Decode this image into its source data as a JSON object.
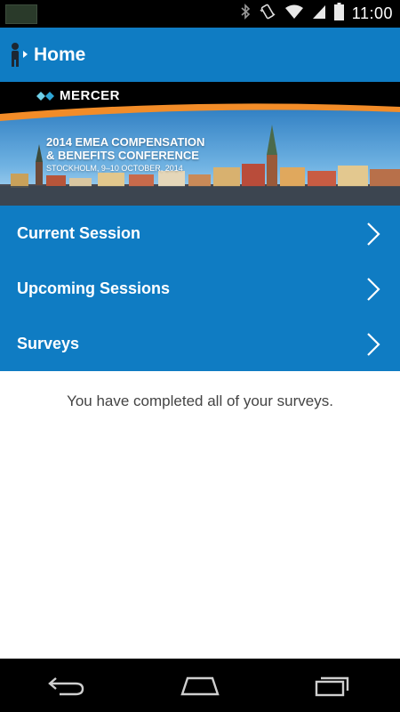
{
  "status_bar": {
    "time": "11:00",
    "icons": [
      "bluetooth-icon",
      "vibrate-icon",
      "wifi-icon",
      "signal-icon",
      "battery-icon"
    ]
  },
  "action_bar": {
    "title": "Home",
    "background": "#0f7cc3"
  },
  "banner": {
    "brand": "MERCER",
    "title_line1": "2014 EMEA COMPENSATION",
    "title_line2": "& BENEFITS CONFERENCE",
    "subtitle": "STOCKHOLM, 9–10 OCTOBER, 2014",
    "accent_color": "#f28c28"
  },
  "menu": {
    "items": [
      {
        "label": "Current Session"
      },
      {
        "label": "Upcoming Sessions"
      },
      {
        "label": "Surveys"
      }
    ]
  },
  "content": {
    "message": "You have completed all of your surveys."
  },
  "nav_bar": {
    "buttons": [
      "back-icon",
      "home-icon",
      "recent-apps-icon"
    ]
  }
}
